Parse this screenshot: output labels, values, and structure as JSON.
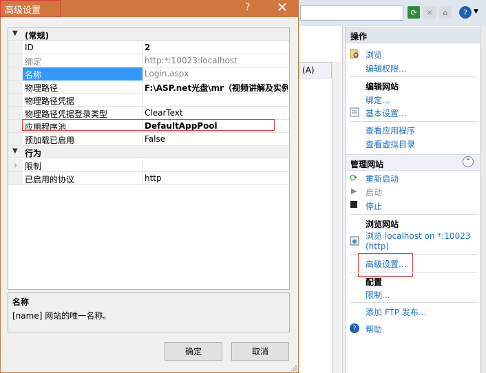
{
  "dialog": {
    "title": "高级设置",
    "help": "?",
    "close": "✕",
    "categories": [
      {
        "label": "(常规)",
        "rows": [
          {
            "name": "ID",
            "value": "2",
            "style": "bold"
          },
          {
            "name": "绑定",
            "value": "http:*:10023:localhost",
            "style": "gray"
          },
          {
            "name": "名称",
            "value": "Login.aspx",
            "style": "gray"
          },
          {
            "name": "物理路径",
            "value": "F:\\ASP.net光盘\\mr（视频讲解及实例源",
            "style": "bold"
          },
          {
            "name": "物理路径凭据",
            "value": "",
            "style": "normal"
          },
          {
            "name": "物理路径凭据登录类型",
            "value": "ClearText",
            "style": "normal"
          },
          {
            "name": "应用程序池",
            "value": "DefaultAppPool",
            "style": "bold"
          },
          {
            "name": "预加载已启用",
            "value": "False",
            "style": "normal"
          }
        ]
      },
      {
        "label": "行为",
        "rows": [
          {
            "name": "限制",
            "value": "",
            "style": "normal"
          },
          {
            "name": "已启用的协议",
            "value": "http",
            "style": "normal"
          }
        ]
      }
    ],
    "description": {
      "title": "名称",
      "text": "[name] 网站的唯一名称。"
    },
    "ok_label": "确定",
    "cancel_label": "取消"
  },
  "background": {
    "bar_label": "(A)",
    "actions_title": "操作",
    "browse": "浏览",
    "edit_permissions": "编辑权限...",
    "edit_site_title": "编辑网站",
    "bindings": "绑定...",
    "basic_settings": "基本设置...",
    "view_apps": "查看应用程序",
    "view_vdirs": "查看虚拟目录",
    "manage_site_title": "管理网站",
    "restart": "重新启动",
    "start": "启动",
    "stop": "停止",
    "browse_site_title": "浏览网站",
    "browse_localhost": "浏览 localhost on *:10023",
    "browse_http": "(http)",
    "advanced_settings": "高级设置...",
    "config_title": "配置",
    "limits": "限制...",
    "add_ftp": "添加 FTP 发布...",
    "help": "帮助"
  },
  "colors": {
    "accent_title": "#d07840",
    "selection": "#3399ff",
    "link": "#1a6fc0",
    "highlight_box": "#e0393a"
  }
}
